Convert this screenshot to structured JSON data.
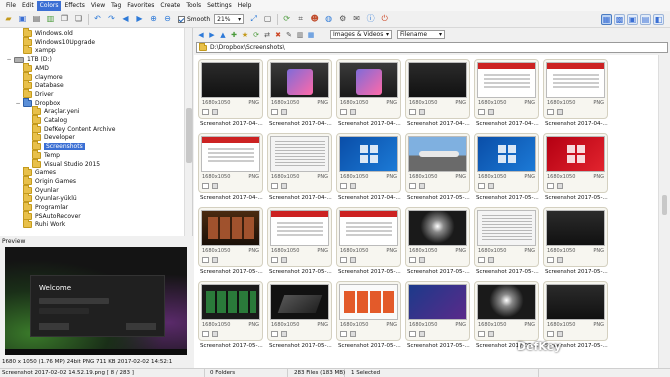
{
  "menu": [
    "File",
    "Edit",
    "Colors",
    "Effects",
    "View",
    "Tag",
    "Favorites",
    "Create",
    "Tools",
    "Settings",
    "Help"
  ],
  "toolbar": {
    "smooth_label": "Smooth",
    "zoom": "21%"
  },
  "tree": [
    {
      "label": "Windows.old",
      "indent": 2,
      "kind": "folder"
    },
    {
      "label": "Windows10Upgrade",
      "indent": 2,
      "kind": "folder"
    },
    {
      "label": "xampp",
      "indent": 2,
      "kind": "folder"
    },
    {
      "label": "1TB (D:)",
      "indent": 1,
      "kind": "drive",
      "expander": "−"
    },
    {
      "label": "AMD",
      "indent": 2,
      "kind": "folder"
    },
    {
      "label": "claymore",
      "indent": 2,
      "kind": "folder"
    },
    {
      "label": "Database",
      "indent": 2,
      "kind": "folder"
    },
    {
      "label": "Driver",
      "indent": 2,
      "kind": "folder"
    },
    {
      "label": "Dropbox",
      "indent": 2,
      "kind": "blue",
      "expander": "−"
    },
    {
      "label": "Araçlar.yeni",
      "indent": 3,
      "kind": "folder"
    },
    {
      "label": "Catalog",
      "indent": 3,
      "kind": "folder"
    },
    {
      "label": "DefKey Content Archive",
      "indent": 3,
      "kind": "folder"
    },
    {
      "label": "Developer",
      "indent": 3,
      "kind": "folder"
    },
    {
      "label": "Screenshots",
      "indent": 3,
      "kind": "folder",
      "selected": true
    },
    {
      "label": "Temp",
      "indent": 3,
      "kind": "folder"
    },
    {
      "label": "Visual Studio 2015",
      "indent": 3,
      "kind": "folder"
    },
    {
      "label": "Games",
      "indent": 2,
      "kind": "folder"
    },
    {
      "label": "Origin Games",
      "indent": 2,
      "kind": "folder"
    },
    {
      "label": "Oyunlar",
      "indent": 2,
      "kind": "folder"
    },
    {
      "label": "Oyunlar-yüklü",
      "indent": 2,
      "kind": "folder"
    },
    {
      "label": "Programlar",
      "indent": 2,
      "kind": "folder"
    },
    {
      "label": "PSAutoRecover",
      "indent": 2,
      "kind": "folder"
    },
    {
      "label": "Ruhi Work",
      "indent": 2,
      "kind": "folder"
    }
  ],
  "preview": {
    "header": "Preview",
    "welcome": "Welcome",
    "info": "1680 x 1050 (1.76 MP)  24bit  PNG    711 KB   2017-02-02 14:52:1"
  },
  "nav": {
    "filter": "Images & Videos",
    "sort": "Filename"
  },
  "path": "D:\\Dropbox\\Screenshots\\",
  "thumbs": [
    {
      "dims": "1680x1050",
      "fmt": "PNG",
      "caption": "Screenshot 2017-04-...",
      "style": "s-dark"
    },
    {
      "dims": "1680x1050",
      "fmt": "PNG",
      "caption": "Screenshot 2017-04-...",
      "style": "s-phone"
    },
    {
      "dims": "1680x1050",
      "fmt": "PNG",
      "caption": "Screenshot 2017-04-...",
      "style": "s-phone"
    },
    {
      "dims": "1680x1050",
      "fmt": "PNG",
      "caption": "Screenshot 2017-04-...",
      "style": "s-dark"
    },
    {
      "dims": "1680x1050",
      "fmt": "PNG",
      "caption": "Screenshot 2017-04-...",
      "style": "s-web"
    },
    {
      "dims": "1680x1050",
      "fmt": "PNG",
      "caption": "Screenshot 2017-04-...",
      "style": "s-web"
    },
    {
      "dims": "1680x1050",
      "fmt": "PNG",
      "caption": "Screenshot 2017-04-...",
      "style": "s-web"
    },
    {
      "dims": "1680x1050",
      "fmt": "PNG",
      "caption": "Screenshot 2017-04-...",
      "style": "s-doc"
    },
    {
      "dims": "1680x1050",
      "fmt": "PNG",
      "caption": "Screenshot 2017-04-...",
      "style": "s-win"
    },
    {
      "dims": "1680x1050",
      "fmt": "PNG",
      "caption": "Screenshot 2017-05-...",
      "style": "s-plane"
    },
    {
      "dims": "1680x1050",
      "fmt": "PNG",
      "caption": "Screenshot 2017-05-...",
      "style": "s-win"
    },
    {
      "dims": "1680x1050",
      "fmt": "PNG",
      "caption": "Screenshot 2017-05-...",
      "style": "s-winred"
    },
    {
      "dims": "1680x1050",
      "fmt": "PNG",
      "caption": "Screenshot 2017-05-...",
      "style": "s-film"
    },
    {
      "dims": "1680x1050",
      "fmt": "PNG",
      "caption": "Screenshot 2017-05-...",
      "style": "s-web"
    },
    {
      "dims": "1680x1050",
      "fmt": "PNG",
      "caption": "Screenshot 2017-05-...",
      "style": "s-web"
    },
    {
      "dims": "1680x1050",
      "fmt": "PNG",
      "caption": "Screenshot 2017-05-...",
      "style": "s-glow"
    },
    {
      "dims": "1680x1050",
      "fmt": "PNG",
      "caption": "Screenshot 2017-05-...",
      "style": "s-doc"
    },
    {
      "dims": "1680x1050",
      "fmt": "PNG",
      "caption": "Screenshot 2017-05-...",
      "style": "s-dark"
    },
    {
      "dims": "1680x1050",
      "fmt": "PNG",
      "caption": "Screenshot 2017-05-...",
      "style": "s-media"
    },
    {
      "dims": "1680x1050",
      "fmt": "PNG",
      "caption": "Screenshot 2017-05-...",
      "style": "s-laptop"
    },
    {
      "dims": "1680x1050",
      "fmt": "PNG",
      "caption": "Screenshot 2017-05-...",
      "style": "s-store"
    },
    {
      "dims": "1680x1050",
      "fmt": "PNG",
      "caption": "Screenshot 2017-05-...",
      "style": "s-clock"
    },
    {
      "dims": "1680x1050",
      "fmt": "PNG",
      "caption": "Screenshot 2017-05-...",
      "style": "s-glow"
    },
    {
      "dims": "1680x1050",
      "fmt": "PNG",
      "caption": "Screenshot 2017-05-...",
      "style": "s-dark"
    }
  ],
  "watermark": "DefKey",
  "status": {
    "file": "Screenshot 2017-02-02 14.52.19.png  [ 8 / 283 ]",
    "folders": "0 Folders",
    "files": "283 Files (183 MB)",
    "selected": "1 Selected"
  },
  "colors": {
    "selection": "#3b6fd4",
    "folder": "#e8c04a"
  }
}
